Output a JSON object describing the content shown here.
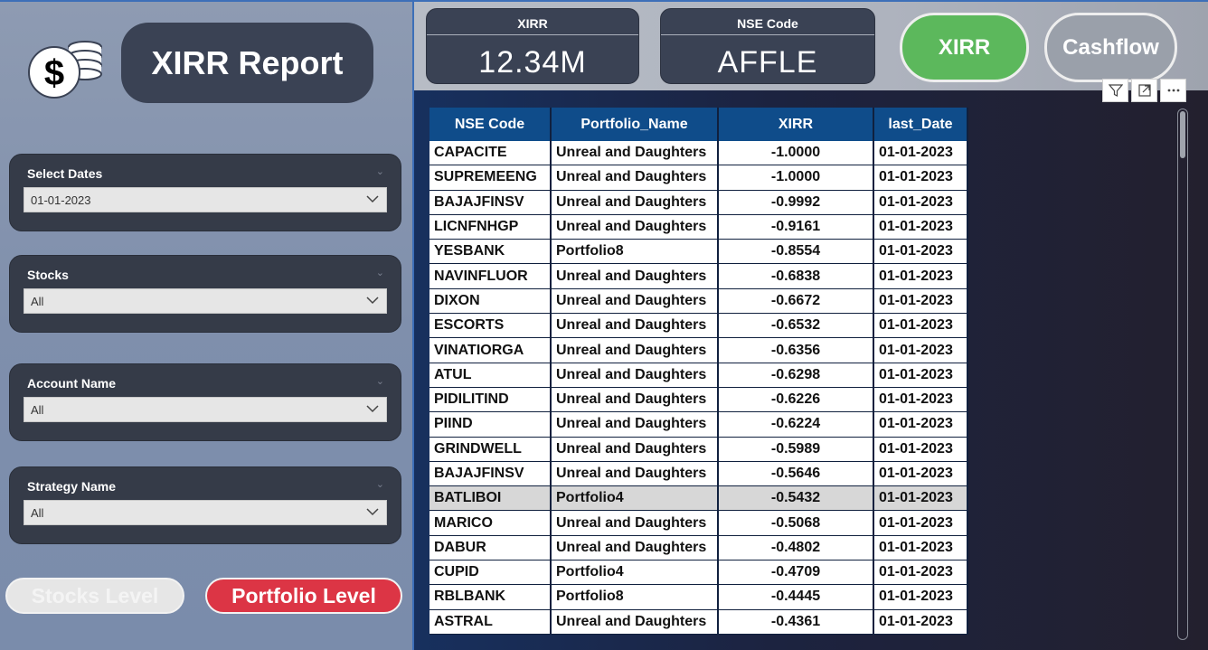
{
  "report": {
    "title": "XIRR Report"
  },
  "slicers": [
    {
      "label": "Select Dates",
      "value": "01-01-2023"
    },
    {
      "label": "Stocks",
      "value": "All"
    },
    {
      "label": "Account Name",
      "value": "All"
    },
    {
      "label": "Strategy Name",
      "value": "All"
    }
  ],
  "buttons": {
    "stocks_level": "Stocks Level",
    "portfolio_level": "Portfolio Level",
    "xirr": "XIRR",
    "cashflow": "Cashflow"
  },
  "cards": {
    "xirr": {
      "label": "XIRR",
      "value": "12.34M"
    },
    "nse_code": {
      "label": "NSE Code",
      "value": "AFFLE"
    }
  },
  "table": {
    "columns": [
      "NSE Code",
      "Portfolio_Name",
      "XIRR",
      "last_Date"
    ],
    "rows": [
      [
        "CAPACITE",
        "Unreal and Daughters",
        "-1.0000",
        "01-01-2023"
      ],
      [
        "SUPREMEENG",
        "Unreal and Daughters",
        "-1.0000",
        "01-01-2023"
      ],
      [
        "BAJAJFINSV",
        "Unreal and Daughters",
        "-0.9992",
        "01-01-2023"
      ],
      [
        "LICNFNHGP",
        "Unreal and Daughters",
        "-0.9161",
        "01-01-2023"
      ],
      [
        "YESBANK",
        "Portfolio8",
        "-0.8554",
        "01-01-2023"
      ],
      [
        "NAVINFLUOR",
        "Unreal and Daughters",
        "-0.6838",
        "01-01-2023"
      ],
      [
        "DIXON",
        "Unreal and Daughters",
        "-0.6672",
        "01-01-2023"
      ],
      [
        "ESCORTS",
        "Unreal and Daughters",
        "-0.6532",
        "01-01-2023"
      ],
      [
        "VINATIORGA",
        "Unreal and Daughters",
        "-0.6356",
        "01-01-2023"
      ],
      [
        "ATUL",
        "Unreal and Daughters",
        "-0.6298",
        "01-01-2023"
      ],
      [
        "PIDILITIND",
        "Unreal and Daughters",
        "-0.6226",
        "01-01-2023"
      ],
      [
        "PIIND",
        "Unreal and Daughters",
        "-0.6224",
        "01-01-2023"
      ],
      [
        "GRINDWELL",
        "Unreal and Daughters",
        "-0.5989",
        "01-01-2023"
      ],
      [
        "BAJAJFINSV",
        "Unreal and Daughters",
        "-0.5646",
        "01-01-2023"
      ],
      [
        "BATLIBOI",
        "Portfolio4",
        "-0.5432",
        "01-01-2023"
      ],
      [
        "MARICO",
        "Unreal and Daughters",
        "-0.5068",
        "01-01-2023"
      ],
      [
        "DABUR",
        "Unreal and Daughters",
        "-0.4802",
        "01-01-2023"
      ],
      [
        "CUPID",
        "Portfolio4",
        "-0.4709",
        "01-01-2023"
      ],
      [
        "RBLBANK",
        "Portfolio8",
        "-0.4445",
        "01-01-2023"
      ],
      [
        "ASTRAL",
        "Unreal and Daughters",
        "-0.4361",
        "01-01-2023"
      ]
    ],
    "highlighted_row": 14
  },
  "icons": {
    "logo": "dollar-coins-icon",
    "filter": "filter-icon",
    "focus": "focus-mode-icon",
    "more": "more-options-icon",
    "dropdown": "chevron-down-icon"
  },
  "colors": {
    "xirr_button": "#5cb85c",
    "portfolio_level_button": "#dc3545",
    "table_header": "#0f4c8a"
  }
}
